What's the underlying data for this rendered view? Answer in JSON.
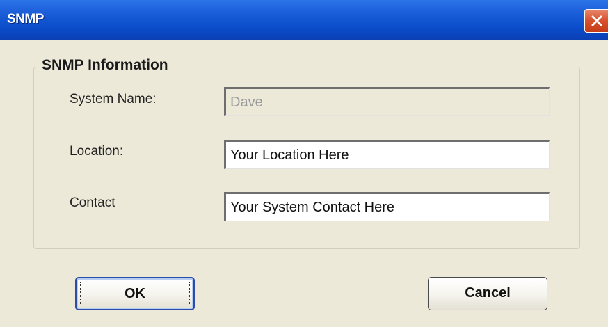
{
  "window": {
    "title": "SNMP"
  },
  "group": {
    "legend": "SNMP Information"
  },
  "fields": {
    "system_name": {
      "label": "System Name:",
      "value": "Dave"
    },
    "location": {
      "label": "Location:",
      "value": "Your Location Here"
    },
    "contact": {
      "label": "Contact",
      "value": "Your System Contact Here"
    }
  },
  "buttons": {
    "ok_label": "OK",
    "cancel_label": "Cancel"
  },
  "icons": {
    "close": "close-icon"
  },
  "colors": {
    "titlebar": "#0a4cc9",
    "close_button": "#d8502c",
    "dialog_background": "#ece9d8"
  }
}
